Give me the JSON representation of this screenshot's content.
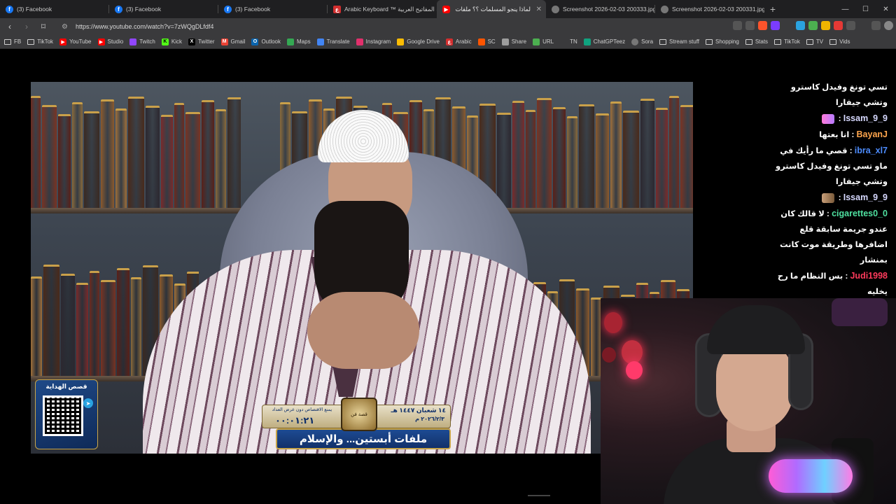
{
  "tabs": [
    {
      "title": "(3) Facebook",
      "icon": "facebook-icon",
      "color": "#1877f2",
      "active": false
    },
    {
      "title": "(3) Facebook",
      "icon": "facebook-icon",
      "color": "#1877f2",
      "active": false
    },
    {
      "title": "(3) Facebook",
      "icon": "facebook-icon",
      "color": "#1877f2",
      "active": false
    },
    {
      "title": "Arabic Keyboard ™ لوحة المفاتيح العربية",
      "icon": "arabic-keyboard-icon",
      "color": "#d32f2f",
      "active": false
    },
    {
      "title": "لماذا ينجو المسلمات ؟؟ ملفات جزيرة",
      "icon": "youtube-icon",
      "color": "#ff0000",
      "active": true
    },
    {
      "title": "Screenshot 2026-02-03 200333.jpg",
      "icon": "globe-icon",
      "color": "#9e9e9e",
      "active": false
    },
    {
      "title": "Screenshot 2026-02-03 200331.jpg",
      "icon": "globe-icon",
      "color": "#9e9e9e",
      "active": false
    }
  ],
  "address": {
    "url": "https://www.youtube.com/watch?v=7zWQgDLfdf4"
  },
  "bookmarks": [
    {
      "label": "FB",
      "icon": "folder-icon"
    },
    {
      "label": "TikTok",
      "icon": "folder-icon"
    },
    {
      "label": "YouTube",
      "icon": "youtube-icon",
      "color": "#ff0000"
    },
    {
      "label": "Studio",
      "icon": "youtube-studio-icon",
      "color": "#ff0000"
    },
    {
      "label": "Twitch",
      "icon": "twitch-icon",
      "color": "#9146ff"
    },
    {
      "label": "Kick",
      "icon": "kick-icon",
      "color": "#53fc18"
    },
    {
      "label": "Twitter",
      "icon": "x-icon",
      "color": "#000000"
    },
    {
      "label": "Gmail",
      "icon": "gmail-icon",
      "color": "#ea4335"
    },
    {
      "label": "Outlook",
      "icon": "outlook-icon",
      "color": "#0a64ad"
    },
    {
      "label": "Maps",
      "icon": "maps-icon",
      "color": "#34a853"
    },
    {
      "label": "Translate",
      "icon": "translate-icon",
      "color": "#4285f4"
    },
    {
      "label": "Instagram",
      "icon": "instagram-icon",
      "color": "#e1306c"
    },
    {
      "label": "Google Drive",
      "icon": "drive-icon",
      "color": "#fbbc04"
    },
    {
      "label": "Arabic",
      "icon": "arabic-keyboard-icon",
      "color": "#d32f2f"
    },
    {
      "label": "SC",
      "icon": "sc-icon",
      "color": "#ff5500"
    },
    {
      "label": "Share",
      "icon": "cloud-icon",
      "color": "#9e9e9e"
    },
    {
      "label": "URL",
      "icon": "url-icon",
      "color": "#4caf50"
    },
    {
      "label": "TN",
      "icon": "globe-icon",
      "color": "#757575"
    },
    {
      "label": "ChatGPTeez",
      "icon": "chatgpt-icon",
      "color": "#10a37f"
    },
    {
      "label": "Sora",
      "icon": "sora-icon",
      "color": "#bbbbbb"
    },
    {
      "label": "Stream stuff",
      "icon": "folder-icon"
    },
    {
      "label": "Shopping",
      "icon": "folder-icon"
    },
    {
      "label": "Stats",
      "icon": "folder-icon"
    },
    {
      "label": "TikTok",
      "icon": "folder-icon"
    },
    {
      "label": "TV",
      "icon": "folder-icon"
    },
    {
      "label": "Vids",
      "icon": "folder-icon"
    }
  ],
  "video": {
    "qr_title": "قصص الهداية",
    "banner_title": "ملفات أبستين... والإسلام",
    "banner_logo": "قصة فن",
    "banner_date_hijri": "١٤ شعبان ١٤٤٧ هـ",
    "banner_date_greg": "٢٠٢٦/٢/٣ م",
    "banner_note": "يمنع الاقتصاص دون عرض العداد",
    "banner_timer": "٠٠:٠١:٢١"
  },
  "chat": [
    {
      "user": "",
      "message": "تسي تونغ وفيدل كاسترو وتشي جيفارا",
      "user_color": "#ffffff"
    },
    {
      "user": "Issam_9_9",
      "message": "",
      "user_color": "#d7d9ff",
      "emote": "dance-emote"
    },
    {
      "user": "BayanJ",
      "message": "انا بعتها",
      "user_color": "#ffa64d"
    },
    {
      "user": "ibra_xl7",
      "message": "قصي ما رأيك في ماو تسي تونغ وفيدل كاسترو وتشي جيفارا",
      "user_color": "#4d8dff"
    },
    {
      "user": "Issam_9_9",
      "message": "",
      "user_color": "#d7d9ff",
      "emote": "cat-emote"
    },
    {
      "user": "cigarettes0_0",
      "message": "لا قالك كان عندو جريمة سابقة قلع اضافرها وطريقة موت كانت بمنشار",
      "user_color": "#4fe0a0"
    },
    {
      "user": "Judi1998",
      "message": "بس النظام ما رح يخليه",
      "user_color": "#ff3b5c"
    }
  ]
}
